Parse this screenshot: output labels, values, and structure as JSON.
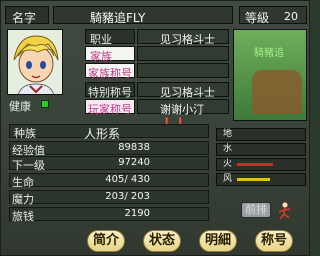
{
  "header": {
    "name_label": "名字",
    "name": "騎豬追FLY",
    "level_label": "等級",
    "level": "20"
  },
  "profile": {
    "job_label": "职业",
    "job": "见习格斗士",
    "family_label": "家族",
    "family": "",
    "family_title_label": "家族称号",
    "family_title": "",
    "special_title_label": "特别称号",
    "special_title": "见习格斗士",
    "player_title_label": "玩家称号",
    "player_title": "谢谢小汀❗❗",
    "health_label": "健康"
  },
  "stats": {
    "race_label": "种族",
    "race": "人形系",
    "exp_label": "经验值",
    "exp": "89838",
    "next_label": "下一级",
    "next": "97240",
    "hp_label": "生命",
    "hp": "405/ 430",
    "mp_label": "魔力",
    "mp": "203/ 203",
    "stone_label": "旅钱",
    "stone": "2190"
  },
  "elements": [
    {
      "label": "地",
      "value": 0,
      "color": "#a06a3a"
    },
    {
      "label": "水",
      "value": 0,
      "color": "#3a6ad0"
    },
    {
      "label": "火",
      "value": 0.55,
      "color": "#d02a2a"
    },
    {
      "label": "风",
      "value": 0.5,
      "color": "#e0c21a"
    }
  ],
  "side_text": "騎豬追",
  "buttons": {
    "intro": "简介",
    "status": "状态",
    "detail": "明細",
    "title": "称号",
    "prev": "前排"
  },
  "icons": {
    "portrait": "character-portrait",
    "health": "health-indicator",
    "figure": "running-figure-icon"
  }
}
